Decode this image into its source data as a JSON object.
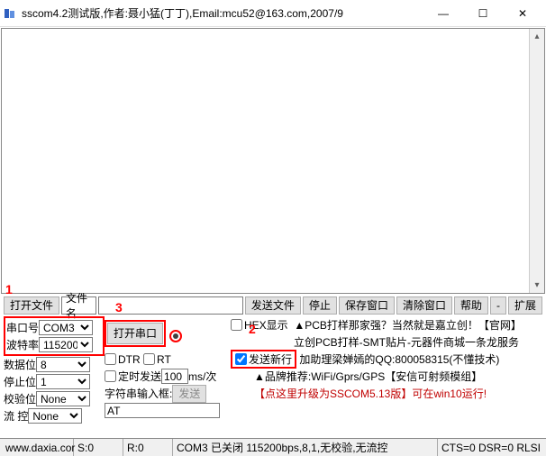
{
  "title": "sscom4.2测试版,作者:聂小猛(丁丁),Email:mcu52@163.com,2007/9",
  "markers": {
    "m1": "1",
    "m2": "2",
    "m3": "3"
  },
  "filerow": {
    "open_file": "打开文件",
    "filename_label": "文件名",
    "filename": "",
    "send_file": "发送文件",
    "stop": "停止",
    "save_win": "保存窗口",
    "clear_win": "清除窗口",
    "help": "帮助",
    "min": "-",
    "expand": "扩展"
  },
  "serial": {
    "port_label": "串口号",
    "port": "COM3",
    "baud_label": "波特率",
    "baud": "115200",
    "open_port": "打开串口",
    "databits_label": "数据位",
    "databits": "8",
    "stopbits_label": "停止位",
    "stopbits": "1",
    "parity_label": "校验位",
    "parity": "None",
    "flow_label": "流 控",
    "flow": "None",
    "dtr": "DTR",
    "rts": "RT",
    "hex_show": "HEX显示",
    "send_newline": "发送新行",
    "timed_send": "定时发送",
    "timed_value": "100",
    "timed_unit": "ms/次",
    "input_label": "字符串输入框:",
    "send_btn": "发送",
    "input_value": "AT"
  },
  "promo": {
    "line1": "PCB打样那家强？当然就是嘉立创！【官网】",
    "line2": "立创PCB打样-SMT贴片-元器件商城一条龙服务",
    "line3": "加助理梁婵嫣的QQ:800058315(不懂技术)",
    "line4": "品牌推荐:WiFi/Gprs/GPS【安信可射频模组】",
    "line5": "【点这里升级为SSCOM5.13版】可在win10运行!"
  },
  "status": {
    "site": "www.daxia.cor",
    "s": "S:0",
    "r": "R:0",
    "conn": "COM3 已关闭 115200bps,8,1,无校验,无流控",
    "cts": "CTS=0 DSR=0 RLSI"
  }
}
